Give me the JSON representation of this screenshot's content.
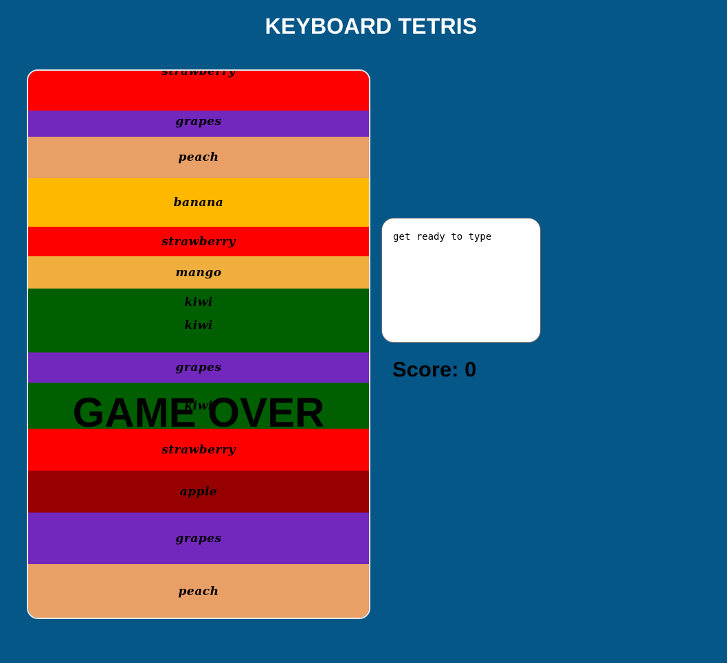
{
  "header": {
    "title": "KEYBOARD TETRIS"
  },
  "board": {
    "blocks": [
      {
        "word": "strawberry",
        "color": "#ff0000"
      },
      {
        "word": "grapes",
        "color": "#7228bc"
      },
      {
        "word": "peach",
        "color": "#e8a067"
      },
      {
        "word": "banana",
        "color": "#ffb800"
      },
      {
        "word": "strawberry",
        "color": "#ff0000"
      },
      {
        "word": "mango",
        "color": "#f0ae3f"
      },
      {
        "word": "kiwi",
        "color": "#005f00"
      },
      {
        "word": "kiwi",
        "color": "#005f00"
      },
      {
        "word": "grapes",
        "color": "#7228bc"
      },
      {
        "word": "kiwi",
        "color": "#005f00"
      },
      {
        "word": "strawberry",
        "color": "#ff0000"
      },
      {
        "word": "apple",
        "color": "#960000"
      },
      {
        "word": "grapes",
        "color": "#7228bc"
      },
      {
        "word": "peach",
        "color": "#e8a067"
      }
    ],
    "status": "GAME OVER"
  },
  "typing": {
    "prompt": "get ready to type"
  },
  "score": {
    "label": "Score: 0"
  }
}
